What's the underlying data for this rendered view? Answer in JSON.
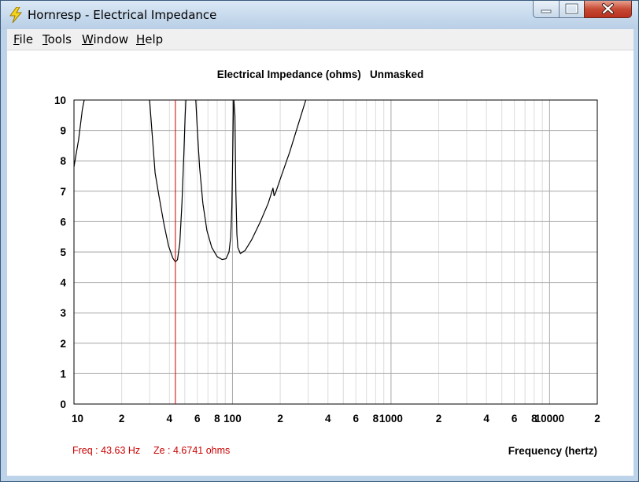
{
  "window": {
    "title": "Hornresp - Electrical Impedance"
  },
  "menu": {
    "items": [
      "File",
      "Tools",
      "Window",
      "Help"
    ]
  },
  "colors": {
    "curve": "#000000",
    "cursor": "#cc0000",
    "grid_major": "#a6a6a6",
    "grid_minor": "#dcdcdc",
    "readout": "#cc0000"
  },
  "status": {
    "freq": "Freq : 43.63 Hz",
    "ze": "Ze : 4.6741 ohms"
  },
  "chart_data": {
    "type": "line",
    "title": "Electrical Impedance (ohms)   Unmasked",
    "xlabel": "Frequency (hertz)",
    "ylabel": "",
    "x_scale": "log",
    "xlim": [
      10,
      20000
    ],
    "ylim": [
      0,
      10
    ],
    "grid": true,
    "x_tick_labels": [
      {
        "value": 10,
        "label": "10"
      },
      {
        "value": 20,
        "label": "2"
      },
      {
        "value": 40,
        "label": "4"
      },
      {
        "value": 60,
        "label": "6"
      },
      {
        "value": 80,
        "label": "8"
      },
      {
        "value": 100,
        "label": "100"
      },
      {
        "value": 200,
        "label": "2"
      },
      {
        "value": 400,
        "label": "4"
      },
      {
        "value": 600,
        "label": "6"
      },
      {
        "value": 800,
        "label": "8"
      },
      {
        "value": 1000,
        "label": "1000"
      },
      {
        "value": 2000,
        "label": "2"
      },
      {
        "value": 4000,
        "label": "4"
      },
      {
        "value": 6000,
        "label": "6"
      },
      {
        "value": 8000,
        "label": "8"
      },
      {
        "value": 10000,
        "label": "10000"
      },
      {
        "value": 20000,
        "label": "2"
      }
    ],
    "y_ticks": [
      0,
      1,
      2,
      3,
      4,
      5,
      6,
      7,
      8,
      9,
      10
    ],
    "cursor": {
      "x": 43.63,
      "y": 4.6741
    },
    "series": [
      {
        "points": [
          [
            10.0,
            7.8
          ],
          [
            10.3,
            8.2
          ],
          [
            10.7,
            8.7
          ],
          [
            11.0,
            9.2
          ],
          [
            11.3,
            9.7
          ],
          [
            11.6,
            10
          ]
        ]
      },
      {
        "points": [
          [
            30.0,
            10
          ],
          [
            31.0,
            9.0
          ],
          [
            32.5,
            7.6
          ],
          [
            34.5,
            6.8
          ],
          [
            37.0,
            5.9
          ],
          [
            39.5,
            5.2
          ],
          [
            42.0,
            4.8
          ],
          [
            43.63,
            4.6741
          ],
          [
            45.0,
            4.75
          ],
          [
            46.5,
            5.3
          ],
          [
            48.0,
            6.6
          ],
          [
            49.3,
            8.2
          ],
          [
            50.3,
            9.5
          ],
          [
            50.8,
            10
          ]
        ]
      },
      {
        "points": [
          [
            58.7,
            10
          ],
          [
            60.0,
            9.0
          ],
          [
            62.0,
            7.8
          ],
          [
            65.0,
            6.6
          ],
          [
            69.0,
            5.7
          ],
          [
            74.0,
            5.15
          ],
          [
            80.0,
            4.85
          ],
          [
            86.0,
            4.75
          ],
          [
            91.0,
            4.78
          ],
          [
            95.0,
            5.0
          ],
          [
            97.5,
            5.5
          ],
          [
            99.0,
            6.5
          ],
          [
            100.0,
            7.8
          ],
          [
            101.0,
            9.2
          ],
          [
            101.6,
            10
          ]
        ]
      },
      {
        "points": [
          [
            102.0,
            10
          ],
          [
            103.5,
            9.5
          ],
          [
            105.0,
            7.0
          ],
          [
            106.5,
            5.6
          ],
          [
            108.0,
            5.15
          ],
          [
            112.0,
            4.95
          ],
          [
            120.0,
            5.05
          ],
          [
            132.0,
            5.4
          ],
          [
            150.0,
            6.0
          ],
          [
            168.0,
            6.6
          ],
          [
            180.0,
            7.1
          ],
          [
            183.0,
            6.85
          ],
          [
            187.0,
            6.95
          ],
          [
            200.0,
            7.4
          ],
          [
            230.0,
            8.3
          ],
          [
            260.0,
            9.2
          ],
          [
            282.0,
            9.8
          ],
          [
            290.0,
            10
          ]
        ]
      }
    ]
  }
}
